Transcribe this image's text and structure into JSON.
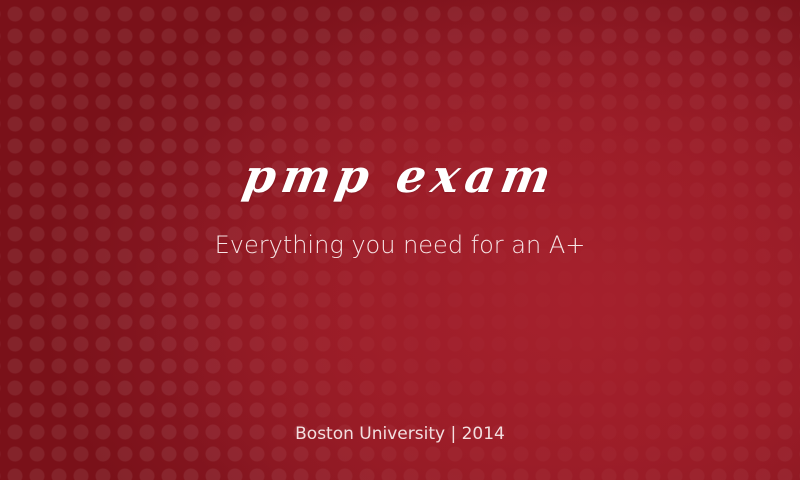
{
  "splash": {
    "title": "pmp exam",
    "subtitle": "Everything you need for an A+",
    "footer": "Boston University | 2014"
  },
  "colors": {
    "background": "#951b24",
    "text": "#ffffff"
  }
}
